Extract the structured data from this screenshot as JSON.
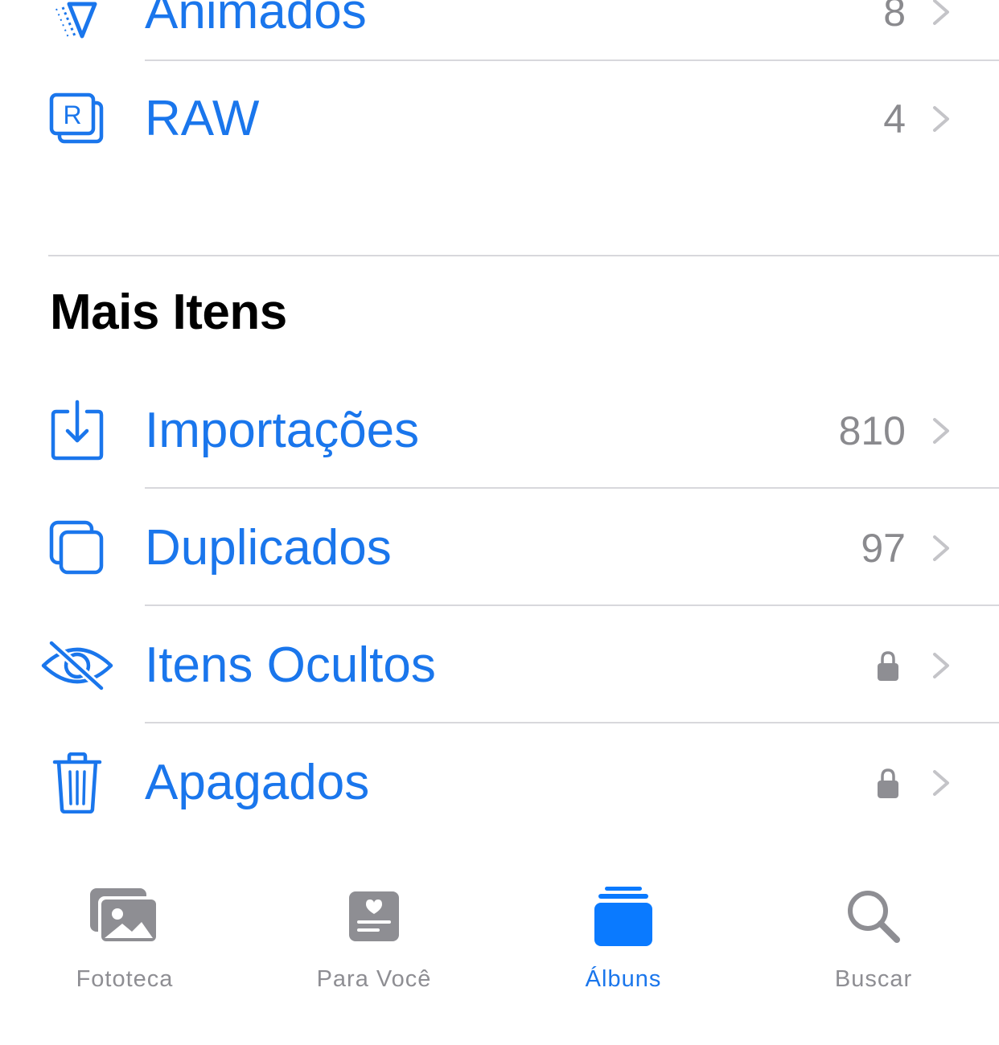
{
  "colors": {
    "accent": "#1a76ec",
    "tab_active": "#0a7aff",
    "secondary_text": "#8a8a8e",
    "tab_inactive": "#8e8e93",
    "separator": "#d8d8dc"
  },
  "top_rows": [
    {
      "label": "Animados",
      "count": "8",
      "icon": "animated-icon"
    },
    {
      "label": "RAW",
      "count": "4",
      "icon": "raw-icon"
    }
  ],
  "more_items": {
    "title": "Mais Itens",
    "rows": [
      {
        "label": "Importações",
        "count": "810",
        "icon": "import-icon"
      },
      {
        "label": "Duplicados",
        "count": "97",
        "icon": "duplicate-icon"
      },
      {
        "label": "Itens Ocultos",
        "locked": true,
        "icon": "eye-slash-icon"
      },
      {
        "label": "Apagados",
        "locked": true,
        "icon": "trash-icon"
      }
    ]
  },
  "tabbar": {
    "tabs": [
      {
        "label": "Fototeca",
        "icon": "photo-library-icon",
        "active": false
      },
      {
        "label": "Para Você",
        "icon": "for-you-icon",
        "active": false
      },
      {
        "label": "Álbuns",
        "icon": "albums-icon",
        "active": true
      },
      {
        "label": "Buscar",
        "icon": "search-icon",
        "active": false
      }
    ]
  }
}
